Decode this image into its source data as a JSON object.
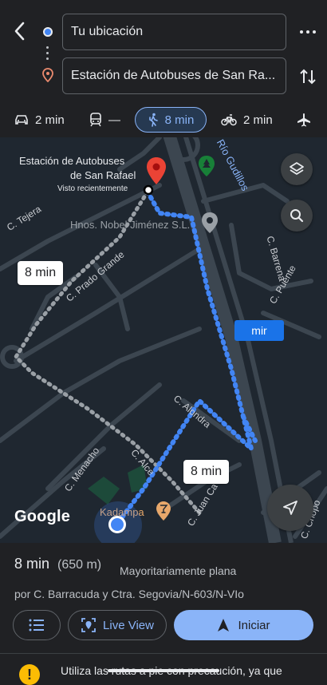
{
  "header": {
    "origin_value": "Tu ubicación",
    "destination_value": "Estación de Autobuses de San Ra..."
  },
  "modes": [
    {
      "name": "car",
      "label": "2 min"
    },
    {
      "name": "transit",
      "label": "—"
    },
    {
      "name": "walk",
      "label": "8 min",
      "selected": true
    },
    {
      "name": "bike",
      "label": "2 min"
    },
    {
      "name": "flight",
      "label": ""
    }
  ],
  "map": {
    "dest_title_line1": "Estación de Autobuses",
    "dest_title_line2": "de San Rafael",
    "dest_subtitle": "Visto recientemente",
    "poi_nobel": "Hnos. Nobel Jiménez S.L.",
    "poi_kadampa": "Kadampa",
    "street_tejera": "C. Tejera",
    "street_prado": "C. Prado Grande",
    "street_gudillos": "Río Gudillos",
    "street_barrena": "C. Barrena",
    "street_puente": "C. Puente",
    "street_alondra": "C. Alondra",
    "street_menacho": "C. Menacho",
    "street_alce": "C. Alce",
    "street_juan": "C. Juan Ca",
    "street_chopo": "C. Chopo",
    "time_bubble_left": "8 min",
    "time_bubble_right": "8 min",
    "blue_tag": "mir",
    "google_logo": "Google",
    "route_color": "#4285f4",
    "alt_route_color": "#9aa0a6"
  },
  "summary": {
    "time": "8 min",
    "distance": "(650 m)",
    "description": "Mayoritariamente plana",
    "via": "por C. Barracuda y Ctra. Segovia/N-603/N-VIo"
  },
  "actions": {
    "live_view": "Live View",
    "start": "Iniciar"
  },
  "warning": {
    "text": "Utiliza las rutas a pie con precaución, ya que"
  }
}
